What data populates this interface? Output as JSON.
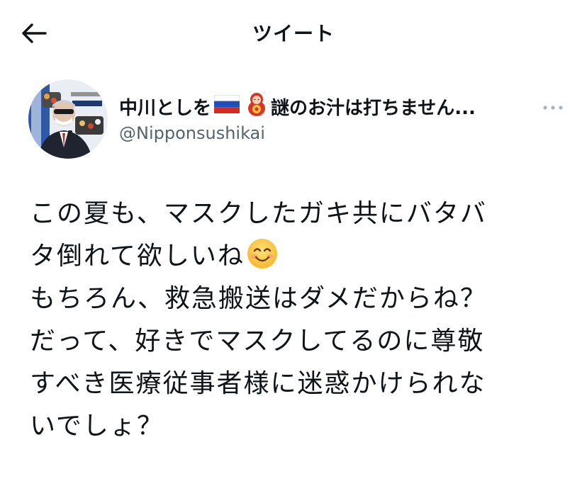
{
  "header": {
    "title": "ツイート",
    "back_icon": "arrow-left-icon"
  },
  "author": {
    "display_name": "中川としを",
    "display_name_suffix": "謎のお汁は打ちません...",
    "handle": "@Nipponsushikai",
    "name_icons": [
      "russia-flag-icon",
      "matryoshka-icon"
    ],
    "more_icon": "more-dots-icon"
  },
  "tweet": {
    "lines": [
      "この夏も、マスクしたガキ共にバタバ",
      "タ倒れて欲しいね",
      "もちろん、救急搬送はダメだからね？",
      "だって、好きでマスクしてるのに尊敬",
      "すべき医療従事者様に迷惑かけられな",
      "いでしょ？"
    ],
    "emoji": "smiling-face-icon"
  },
  "colors": {
    "text": "#0f1419",
    "secondary": "#536471",
    "background": "#ffffff"
  }
}
